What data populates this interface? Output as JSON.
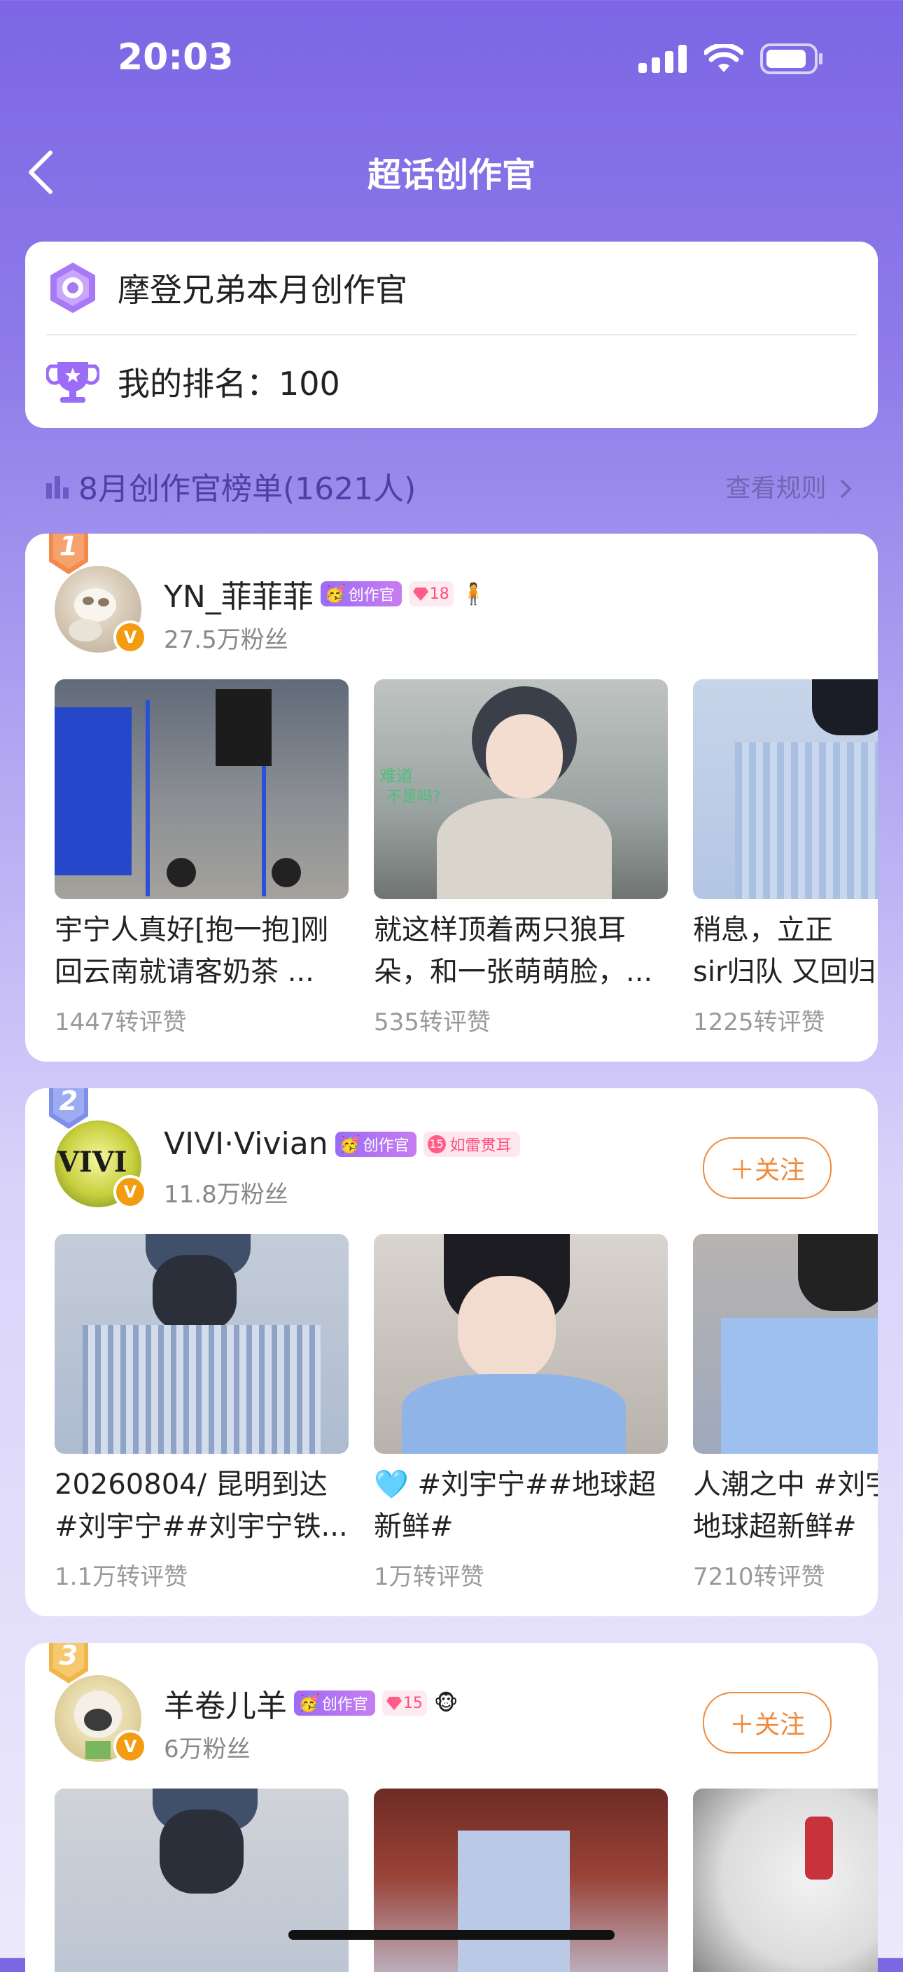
{
  "status": {
    "time": "20:03"
  },
  "nav": {
    "title": "超话创作官"
  },
  "info": {
    "community": "摩登兄弟本月创作官",
    "my_rank": "我的排名：100"
  },
  "leaderboard": {
    "title": "8月创作官榜单(1621人)",
    "rules": "查看规则"
  },
  "colors": {
    "accent": "#7c66e4",
    "follow": "#f08a3c",
    "creator_tag": "#9b6cf5"
  },
  "ranks": [
    {
      "rank": "1",
      "name": "YN_菲菲菲",
      "creator_tag": "创作官",
      "level": "18",
      "level_label": "",
      "fans": "27.5万粉丝",
      "follow": "",
      "posts": [
        {
          "text": "宇宁人真好[抱一抱]刚\n回云南就请客奶茶 ...",
          "stats": "1447转评赞"
        },
        {
          "text": "就这样顶着两只狼耳\n朵，和一张萌萌脸，...",
          "stats": "535转评赞",
          "caption_left": "难道",
          "caption_left2": "不是吗?"
        },
        {
          "text": "稍息，立正\nsir归队 又回归",
          "stats": "1225转评赞"
        }
      ]
    },
    {
      "rank": "2",
      "name": "VIVI·Vivian",
      "creator_tag": "创作官",
      "level": "15",
      "level_label": "如雷贯耳",
      "fans": "11.8万粉丝",
      "follow": "＋关注",
      "posts": [
        {
          "text": "20260804/ 昆明到达\n#刘宇宁##刘宇宁铁...",
          "stats": "1.1万转评赞"
        },
        {
          "text": "🩵 #刘宇宁##地球超\n新鲜#",
          "stats": "1万转评赞"
        },
        {
          "text": "人潮之中 #刘宇\n地球超新鲜#",
          "stats": "7210转评赞"
        }
      ]
    },
    {
      "rank": "3",
      "name": "羊卷儿羊",
      "creator_tag": "创作官",
      "level": "15",
      "level_label": "",
      "fans": "6万粉丝",
      "follow": "＋关注",
      "posts": [
        {
          "text": "",
          "stats": ""
        },
        {
          "text": "",
          "stats": ""
        },
        {
          "text": "",
          "stats": ""
        }
      ]
    }
  ]
}
